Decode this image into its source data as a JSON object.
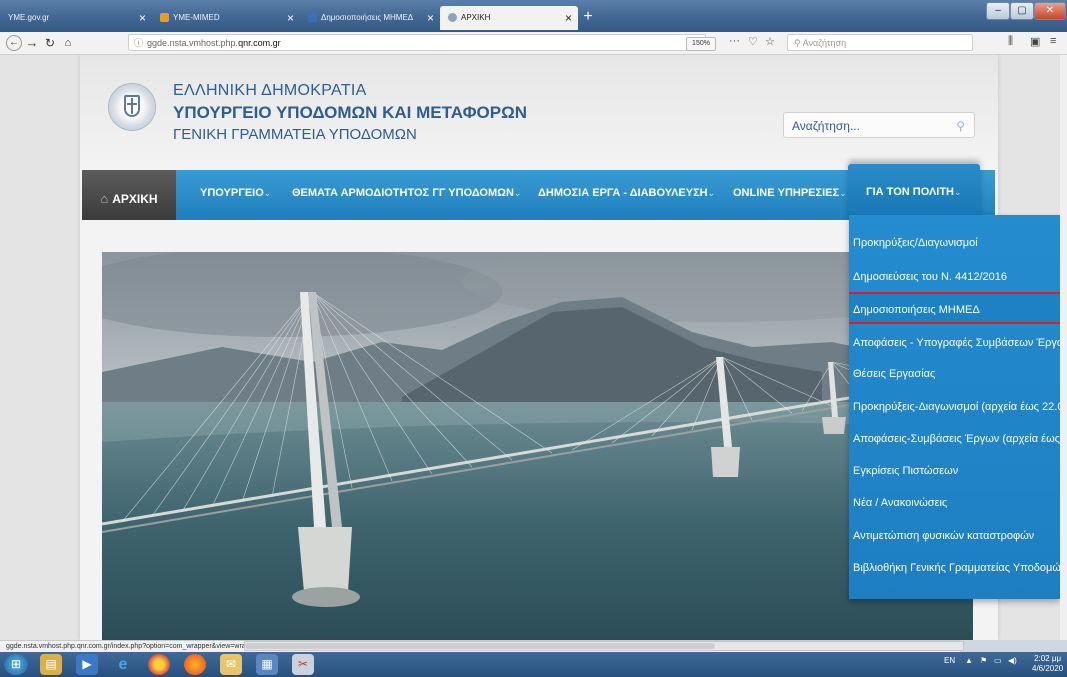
{
  "browser": {
    "tabs": [
      {
        "label": "YME.gov.gr",
        "icon_color": "#2a62a8"
      },
      {
        "label": "YME-MIMED",
        "icon_color": "#e0a21b"
      },
      {
        "label": "Δημοσιοποιήσεις ΜΗΜΕΔ",
        "icon_color": "#3d6fb6"
      },
      {
        "label": "ΑΡΧΙΚΗ",
        "icon_color": "#8aa4c0"
      }
    ],
    "url": "ggde.nsta.vmhost.php.",
    "url_domain": "qnr.com.gr",
    "zoom": "150%",
    "search_placeholder": "Αναζήτηση",
    "window_controls": {
      "minimize": "–",
      "maximize": "▢",
      "close": "✕"
    }
  },
  "site": {
    "org_line1": "ΕΛΛΗΝΙΚΗ ΔΗΜΟΚΡΑΤΙΑ",
    "org_line2": "ΥΠΟΥΡΓΕΙΟ ΥΠΟΔΟΜΩΝ ΚΑΙ ΜΕΤΑΦΟΡΩΝ",
    "org_line3": "ΓΕΝΙΚΗ ΓΡΑΜΜΑΤΕΙΑ ΥΠΟΔΟΜΩΝ",
    "search_placeholder": "Αναζήτηση...",
    "menu": {
      "home": "ΑΡΧΙΚΗ",
      "items": [
        "ΥΠΟΥΡΓΕΙΟ",
        "ΘΕΜΑΤΑ ΑΡΜΟΔΙΟΤΗΤΟΣ ΓΓ ΥΠΟΔΟΜΩΝ",
        "ΔΗΜΟΣΙΑ ΕΡΓΑ - ΔΙΑΒΟΥΛΕΥΣΗ",
        "ONLINE ΥΠΗΡΕΣΙΕΣ",
        "ΓΙΑ ΤΟΝ ΠΟΛΙΤΗ"
      ]
    },
    "dropdown": [
      "Προκηρύξεις/Διαγωνισμοί",
      "Δημοσιεύσεις του Ν. 4412/2016",
      "Δημοσιοποιήσεις ΜΗΜΕΔ",
      "Αποφάσεις - Υπογραφές Συμβάσεων Έργω",
      "Θέσεις Εργασίας",
      "Προκηρύξεις-Διαγωνισμοί (αρχεία έως 22.0",
      "Αποφάσεις-Συμβάσεις Έργων (αρχεία έως",
      "Εγκρίσεις Πιστώσεων",
      "Νέα / Ανακοινώσεις",
      "Αντιμετώπιση φυσικών καταστροφών",
      "Βιβλιοθήκη Γενικής Γραμματείας Υποδομώ"
    ]
  },
  "status_url": "ggde.nsta.vmhost.php.qnr.com.gr/index.php?option=com_wrapper&view=wrapper&Itemid=349",
  "taskbar": {
    "lang": "EN",
    "time": "2:02 μμ",
    "date": "4/6/2020"
  }
}
